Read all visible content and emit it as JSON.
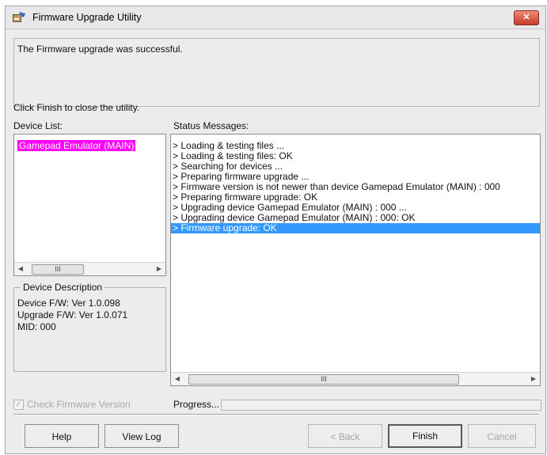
{
  "window": {
    "title": "Firmware Upgrade Utility",
    "close_label": "✕"
  },
  "message": {
    "result": "The Firmware upgrade was successful.",
    "hint": "Click Finish to close the utility."
  },
  "device_list": {
    "label": "Device List:",
    "items": [
      "Gamepad Emulator (MAIN)"
    ],
    "scroll_label": "III"
  },
  "status": {
    "label": "Status Messages:",
    "messages": [
      "> Loading & testing files ...",
      "> Loading & testing files: OK",
      "> Searching for devices ...",
      "> Preparing firmware upgrade ...",
      "> Firmware version is not newer than device Gamepad Emulator (MAIN) : 000",
      "> Preparing firmware upgrade: OK",
      "> Upgrading device Gamepad Emulator (MAIN) : 000 ...",
      "> Upgrading device Gamepad Emulator (MAIN) : 000: OK",
      "> Firmware upgrade: OK"
    ],
    "scroll_label": "III"
  },
  "device_description": {
    "legend": "Device Description",
    "lines": [
      "Device F/W: Ver 1.0.098",
      "Upgrade F/W: Ver 1.0.071",
      "MID: 000"
    ]
  },
  "check_version": {
    "label": "Check Firmware Version",
    "checked": true
  },
  "progress": {
    "label": "Progress...",
    "value_percent": 0
  },
  "buttons": {
    "help": "Help",
    "view_log": "View Log",
    "back": "< Back",
    "finish": "Finish",
    "cancel": "Cancel"
  },
  "colors": {
    "device_highlight": "#ff00ff",
    "selection": "#3399ff",
    "close_button": "#d9503c"
  },
  "icons": {
    "app": "firmware-utility-icon",
    "close": "close-icon",
    "scroll_left": "scroll-left-arrow-icon",
    "scroll_right": "scroll-right-arrow-icon",
    "checkmark": "checkmark-icon"
  }
}
